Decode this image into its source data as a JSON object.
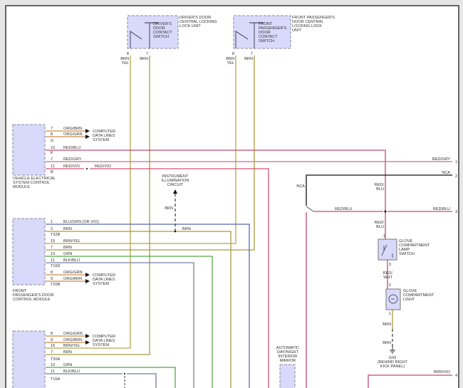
{
  "colors": {
    "brn_yel": "#b3a84a",
    "brn": "#a89a3e",
    "red_blu": "#c4496c",
    "red_gry": "#c7707f",
    "red_vio": "#d2507a",
    "blu_grn": "#5b68aa",
    "grn": "#55a845",
    "blk_blu": "#7b7b9e",
    "org": "#c98b45",
    "nca": "#111111",
    "module_fill": "#d9d9fb"
  },
  "driver_lock_unit": {
    "title": [
      "DRIVER'S DOOR",
      "CENTRAL LOCKING",
      "LOCK UNIT"
    ],
    "switch": [
      "DRIVER'S",
      "DOOR",
      "CONTACT",
      "SWITCH"
    ],
    "pins": [
      {
        "pin": "8",
        "wire": [
          "BRN",
          "YEL"
        ]
      },
      {
        "pin": "7",
        "wire": [
          "BRN"
        ]
      }
    ]
  },
  "passenger_lock_unit": {
    "title": [
      "FRONT PASSENGER'S",
      "DOOR CENTRAL",
      "LOCKING LOCK",
      "UNIT"
    ],
    "switch": [
      "FRONT",
      "PASSENGER'S",
      "DOOR",
      "CONTACT",
      "SWITCH"
    ],
    "pins": [
      {
        "pin": "8",
        "wire": [
          "BRN",
          "YEL"
        ]
      },
      {
        "pin": "7",
        "wire": [
          "BRN"
        ]
      }
    ]
  },
  "vescm": {
    "title": [
      "VEHICLE ELECTRICAL",
      "SYSTEM CONTROL",
      "MODULE"
    ],
    "rows": [
      {
        "pin": "7",
        "wire": "ORG/BRN"
      },
      {
        "pin": "8",
        "wire": "ORG/GRN"
      },
      {
        "pin": "G",
        "wire": ""
      },
      {
        "pin": "10",
        "wire": "RED/BLU"
      },
      {
        "pin": "K",
        "wire": ""
      },
      {
        "pin": "7",
        "wire": "RED/GRY"
      },
      {
        "pin": "11",
        "wire": "RED/VIO"
      },
      {
        "pin": "B",
        "wire": ""
      }
    ],
    "red_vio_2": "RED/VIO",
    "data_lines": [
      "COMPUTER",
      "DATA LINES",
      "SYSTEM"
    ]
  },
  "pass_door_module": {
    "title": [
      "FRONT",
      "PASSENGER'S DOOR",
      "CONTROL MODULE"
    ],
    "rows": [
      {
        "pin": "1",
        "wire": "BLU/GRN (OR VIO)"
      },
      {
        "pin": "2",
        "wire": "BRN"
      },
      {
        "pin": "15",
        "wire": "BRN/YEL"
      },
      {
        "pin": "7",
        "wire": "BRN"
      },
      {
        "pin": "10",
        "wire": "GRN"
      },
      {
        "pin": "11",
        "wire": "BLK/BLU"
      },
      {
        "pin": "8",
        "wire": "ORG/GRN"
      },
      {
        "pin": "9",
        "wire": "ORG/BRN"
      }
    ],
    "connectors": [
      "T32B",
      "T16D",
      "T20B"
    ],
    "data_lines": [
      "COMPUTER",
      "DATA LINES",
      "SYSTEM"
    ]
  },
  "bottom_module": {
    "rows": [
      {
        "pin": "8",
        "wire": "ORG/GRN"
      },
      {
        "pin": "9",
        "wire": "ORG/BRN"
      },
      {
        "pin": "15",
        "wire": "BRN/YEL"
      },
      {
        "pin": "7",
        "wire": "BRN"
      },
      {
        "pin": "10",
        "wire": "GRN"
      },
      {
        "pin": "11",
        "wire": "BLK/BLU"
      }
    ],
    "connectors": [
      "T20A",
      "T16A"
    ],
    "data_lines": [
      "COMPUTER",
      "DATA LINES",
      "SYSTEM"
    ]
  },
  "instrument": {
    "title": [
      "INSTRUMENT",
      "ILLUMINATION",
      "CIRCUIT"
    ],
    "wire1": "BRN",
    "wire2": "BRN"
  },
  "right": {
    "red_gry": "RED/GRY",
    "nca": "NCA",
    "nca_left": "NCA",
    "red_blu_a": [
      "RED/",
      "BLU"
    ],
    "red_blu_b": [
      "RED/",
      "BLU"
    ],
    "red_blu_mid": "RED/BLU",
    "red_blu_right": "RED/BLU",
    "refs": [
      "1",
      "2",
      "3",
      "4"
    ],
    "brn_vio": "BRN/VIO"
  },
  "glove_switch": {
    "title": [
      "GLOVE",
      "COMPARTMENT",
      "LAMP",
      "SWITCH"
    ],
    "pin_top": "1",
    "pin_bottom": "3"
  },
  "red_wht": [
    "RED/",
    "WHT"
  ],
  "glove_light": {
    "title": [
      "GLOVE",
      "COMPARTMENT",
      "LIGHT"
    ],
    "pin_top": "2",
    "pin_bottom": "1"
  },
  "ground": {
    "wire1": "BRN",
    "wire2": "BRN",
    "id": "G43",
    "location": [
      "(BEHIND RIGHT",
      "KICK PANEL)"
    ]
  },
  "mirror": {
    "title": [
      "AUTOMATIC",
      "DAY/NIGHT",
      "INTERIOR",
      "MIRROR"
    ]
  }
}
